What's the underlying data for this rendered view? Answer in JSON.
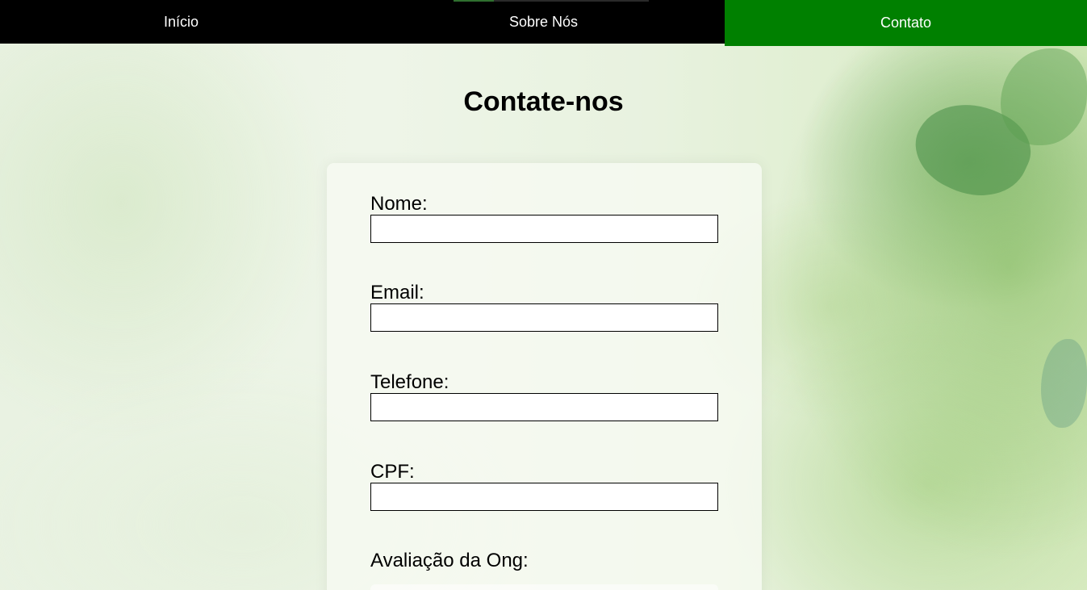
{
  "nav": {
    "items": [
      {
        "label": "Início"
      },
      {
        "label": "Sobre Nós"
      },
      {
        "label": "Contato"
      }
    ],
    "active_color": "#008000",
    "bar_color": "#000000"
  },
  "page": {
    "title": "Contate-nos"
  },
  "form": {
    "fields": [
      {
        "label": "Nome:",
        "value": "",
        "placeholder": ""
      },
      {
        "label": "Email:",
        "value": "",
        "placeholder": ""
      },
      {
        "label": "Telefone:",
        "value": "",
        "placeholder": ""
      },
      {
        "label": "CPF:",
        "value": "",
        "placeholder": ""
      }
    ],
    "rating_label": "Avaliação da Ong:"
  }
}
